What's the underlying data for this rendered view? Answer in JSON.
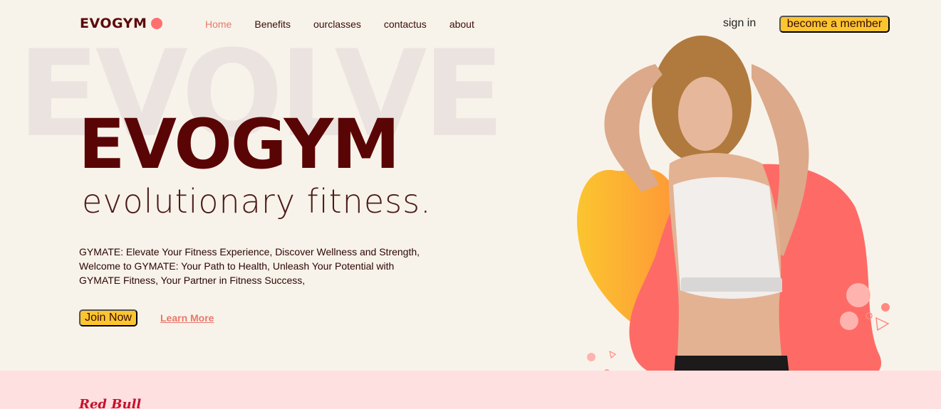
{
  "nav": {
    "logo": "EVOGYM",
    "links": [
      {
        "label": "Home",
        "active": true
      },
      {
        "label": "Benefits",
        "active": false
      },
      {
        "label": "ourclasses",
        "active": false
      },
      {
        "label": "contactus",
        "active": false
      },
      {
        "label": "about",
        "active": false
      }
    ],
    "sign_in": "sign in",
    "member_button": "become a member"
  },
  "hero": {
    "background_word": "EVOLVE",
    "title": "EVOGYM",
    "subtitle": "evolutionary fitness.",
    "description": "GYMATE: Elevate Your Fitness Experience, Discover Wellness and Strength, Welcome to GYMATE: Your Path to Health, Unleash Your Potential with GYMATE Fitness, Your Partner in Fitness Success,",
    "join_button": "Join Now",
    "learn_more": "Learn More"
  },
  "sponsors": {
    "first": "Red Bull"
  },
  "colors": {
    "background": "#f8f3ea",
    "primary_dark": "#5a0505",
    "accent_yellow": "#fbc52f",
    "accent_coral": "#fe7070",
    "sponsor_band": "#ffe0e0"
  }
}
